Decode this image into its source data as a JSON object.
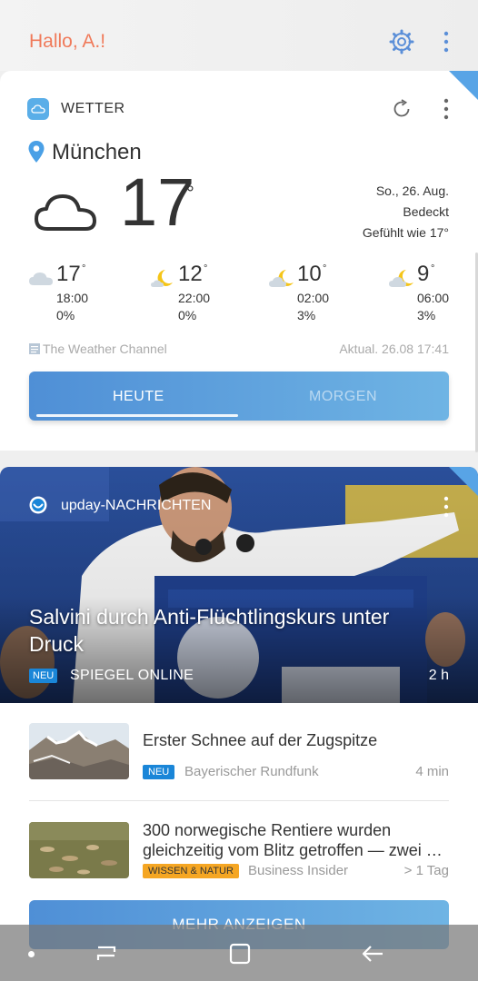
{
  "header": {
    "greeting": "Hallo, A.!",
    "settings_icon": "gear-icon",
    "more_icon": "more-vert-icon"
  },
  "weather": {
    "app_title": "WETTER",
    "city": "München",
    "current_temp": "17",
    "degree": "°",
    "date": "So., 26. Aug.",
    "condition": "Bedeckt",
    "feels_like": "Gefühlt wie 17°",
    "forecast": [
      {
        "temp": "17",
        "time": "18:00",
        "prob": "0%",
        "icon": "cloud-icon"
      },
      {
        "temp": "12",
        "time": "22:00",
        "prob": "0%",
        "icon": "moon-icon"
      },
      {
        "temp": "10",
        "time": "02:00",
        "prob": "3%",
        "icon": "moon-cloud-icon"
      },
      {
        "temp": "9",
        "time": "06:00",
        "prob": "3%",
        "icon": "moon-cloud-icon"
      }
    ],
    "source": "The Weather Channel",
    "updated": "Aktual. 26.08 17:41",
    "tabs": [
      "HEUTE",
      "MORGEN"
    ],
    "active_tab": "HEUTE"
  },
  "news": {
    "app_title": "upday-NACHRICHTEN",
    "hero": {
      "title": "Salvini durch Anti-Flüchtlingskurs unter Druck",
      "badge": "NEU",
      "source": "SPIEGEL ONLINE",
      "time": "2 h"
    },
    "items": [
      {
        "title": "Erster Schnee auf der Zugspitze",
        "badge": "NEU",
        "source": "Bayerischer Rundfunk",
        "time": "4 min"
      },
      {
        "title": "300 norwegische Rentiere wurden gleichzeitig vom Blitz getroffen — zwei …",
        "badge": "WISSEN & NATUR",
        "source": "Business Insider",
        "time": "> 1 Tag"
      }
    ],
    "more_button": "MEHR ANZEIGEN"
  },
  "colors": {
    "greeting": "#f07a5a",
    "accent": "#4f8fd6",
    "badge_blue": "#1a86d8",
    "badge_orange": "#f5a623"
  }
}
